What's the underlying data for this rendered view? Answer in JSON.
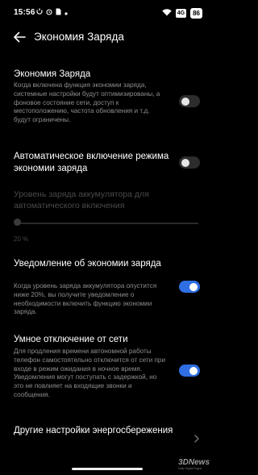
{
  "status": {
    "time": "15:56",
    "left_icons": [
      "sync-icon",
      "alarm-icon",
      "sim-icon",
      "dot-icon"
    ],
    "sim_label": "4G",
    "battery": "86"
  },
  "header": {
    "title": "Экономия Заряда"
  },
  "items": [
    {
      "title": "Экономия Заряда",
      "desc": "Когда включена функция экономии заряда, системные настройки будут оптимизированы, а фоновое состояние сети, доступ к местоположению, частота обновления и т.д. будут ограничены.",
      "state": "off"
    },
    {
      "title": "Автоматическое включение режима экономии заряда",
      "state": "off"
    },
    {
      "title": "Уведомление об экономии заряда",
      "desc": "Когда уровень заряда аккумулятора опустится ниже 20%, вы получите уведомление о необходимости включить функцию экономии заряда.",
      "state": "on"
    },
    {
      "title": "Умное отключение от сети",
      "desc": "Для продления времени автономной работы телефон самостоятельно отключится от сети при входе в режим ожидания в ночное время. Уведомления могут поступать с задержкой, но это не повлияет на входящие звонки и сообщения.",
      "state": "on"
    },
    {
      "title": "Другие настройки энергосбережения"
    }
  ],
  "slider": {
    "label": "Уровень заряда аккумулятора для автоматического включения",
    "value_text": "20 %",
    "value": 0.0
  },
  "watermark": {
    "logo": "3DNews",
    "tagline": "Daily Digital Digest"
  }
}
